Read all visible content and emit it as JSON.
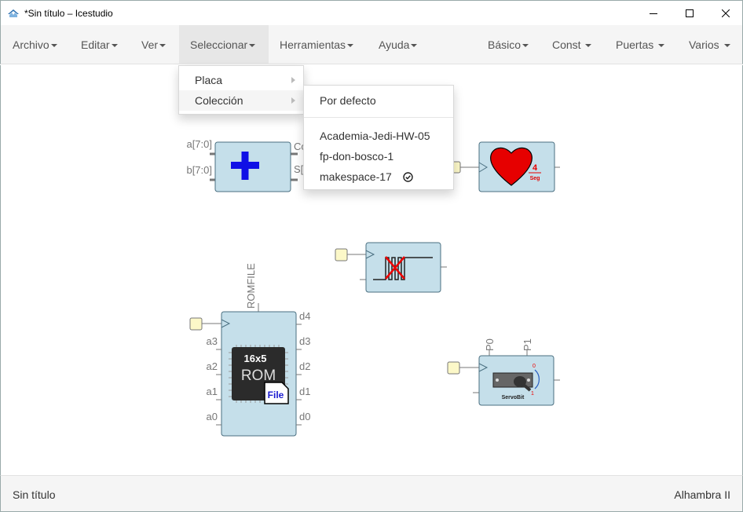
{
  "window": {
    "title": "*Sin título – Icestudio",
    "icon": "icestudio-logo-icon",
    "controls": [
      "minimize-icon",
      "maximize-icon",
      "close-icon"
    ]
  },
  "menubar": {
    "left": [
      {
        "label": "Archivo"
      },
      {
        "label": "Editar"
      },
      {
        "label": "Ver"
      },
      {
        "label": "Seleccionar"
      },
      {
        "label": "Herramientas"
      },
      {
        "label": "Ayuda"
      }
    ],
    "right": [
      {
        "label": "Básico"
      },
      {
        "label": "Const"
      },
      {
        "label": "Puertas"
      },
      {
        "label": "Varios"
      }
    ],
    "active": "Seleccionar"
  },
  "select_menu": {
    "items": [
      {
        "label": "Placa",
        "submenu": true
      },
      {
        "label": "Colección",
        "submenu": true,
        "highlighted": true
      }
    ]
  },
  "collection_submenu": {
    "default": "Por defecto",
    "items": [
      {
        "label": "Academia-Jedi-HW-05",
        "checked": false
      },
      {
        "label": "fp-don-bosco-1",
        "checked": false
      },
      {
        "label": "makespace-17",
        "checked": true
      }
    ]
  },
  "blocks": {
    "adder": {
      "ports_in": [
        "a[7:0]",
        "b[7:0]"
      ],
      "ports_out_partial": [
        "Co",
        "S["
      ],
      "icon": "plus-icon"
    },
    "heart": {
      "icon": "heart-icon",
      "label": "4",
      "sublabel": "Seg"
    },
    "debouncer": {
      "icon": "debounce-signal-icon"
    },
    "rom": {
      "param": "ROMFILE",
      "ports_in": [
        "a3",
        "a2",
        "a1",
        "a0"
      ],
      "ports_out": [
        "d4",
        "d3",
        "d2",
        "d1",
        "d0"
      ],
      "chip_title": "16x5",
      "chip_label": "ROM",
      "file_badge": "File"
    },
    "servo": {
      "params": [
        "P0",
        "P1"
      ],
      "label": "ServoBit",
      "angle_top": "0",
      "angle_bottom": "1"
    }
  },
  "footer": {
    "left": "Sin título",
    "right": "Alhambra II"
  },
  "colors": {
    "block_fill": "#c5dfea",
    "block_stroke": "#4a6f80",
    "clock_fill": "#fcf8c8",
    "menubar_bg": "#f5f5f5",
    "plus": "#1010e6",
    "heart": "#e60000"
  }
}
